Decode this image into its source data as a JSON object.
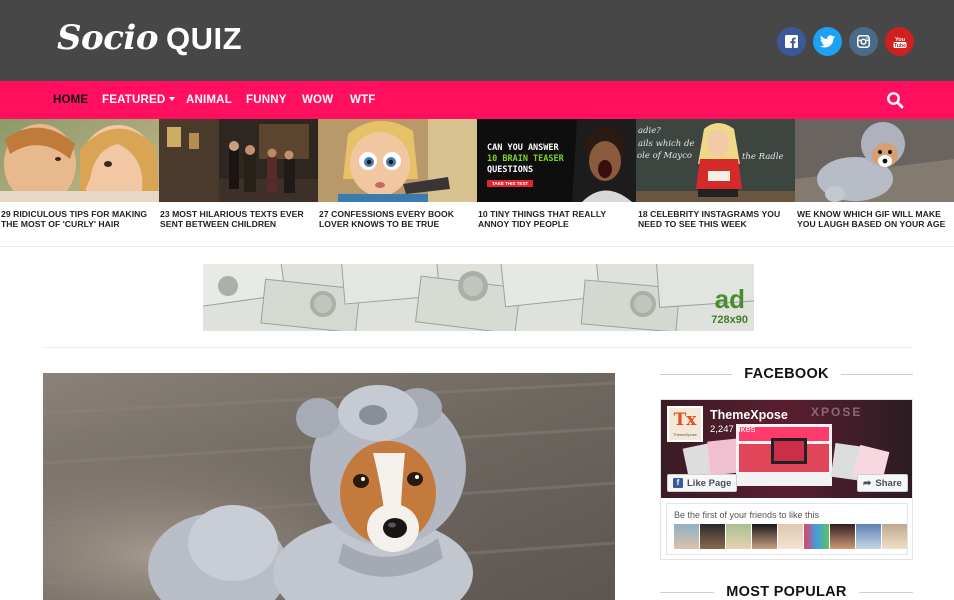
{
  "header": {
    "logo_script": "Socio",
    "logo_bold": "QUIZ",
    "social": [
      {
        "name": "facebook-icon",
        "color": "#3b5998"
      },
      {
        "name": "twitter-icon",
        "color": "#1da1f2"
      },
      {
        "name": "instagram-icon",
        "color": "#4a6a8a"
      },
      {
        "name": "youtube-icon",
        "color": "#cd201f",
        "label": "You\nTube"
      }
    ]
  },
  "nav": {
    "items": [
      {
        "label": "HOME",
        "active": true
      },
      {
        "label": "FEATURED",
        "dropdown": true
      },
      {
        "label": "ANIMAL"
      },
      {
        "label": "FUNNY"
      },
      {
        "label": "WOW"
      },
      {
        "label": "WTF"
      }
    ],
    "search_icon": "search-icon"
  },
  "featured": [
    {
      "caption": "29 RIDICULOUS TIPS FOR MAKING THE MOST OF 'CURLY' HAIR"
    },
    {
      "caption": "23 MOST HILARIOUS TEXTS EVER SENT BETWEEN CHILDREN"
    },
    {
      "caption": "27 CONFESSIONS EVERY BOOK LOVER KNOWS TO BE TRUE"
    },
    {
      "caption": "10 TINY THINGS THAT REALLY ANNOY TIDY PEOPLE",
      "overlay": {
        "line1": "CAN YOU ANSWER",
        "line2": "10 BRAIN TEASER",
        "line3": "QUESTIONS",
        "button": "TAKE THIS TEST"
      }
    },
    {
      "caption": "18 CELEBRITY INSTAGRAMS YOU NEED TO SEE THIS WEEK",
      "board_lines": [
        "adie?",
        "ails which de",
        "ole of Mayco",
        "the Radle"
      ]
    },
    {
      "caption": "WE KNOW WHICH GIF WILL MAKE YOU LAUGH BASED ON YOUR AGE"
    }
  ],
  "ad": {
    "text": "ad",
    "size": "728x90"
  },
  "sidebar": {
    "facebook_heading": "FACEBOOK",
    "popular_heading": "MOST POPULAR",
    "fb": {
      "page_name": "ThemeXpose",
      "likes": "2,247 likes",
      "logo": "Tx",
      "logo_sub": "ThemeXpose",
      "cover_text": "XPOSE",
      "like_button": "Like Page",
      "share_button": "Share",
      "friends_text": "Be the first of your friends to like this"
    }
  },
  "colors": {
    "header_bg": "#474747",
    "nav_bg": "#ff0f5e",
    "accent": "#ff0f5e"
  }
}
